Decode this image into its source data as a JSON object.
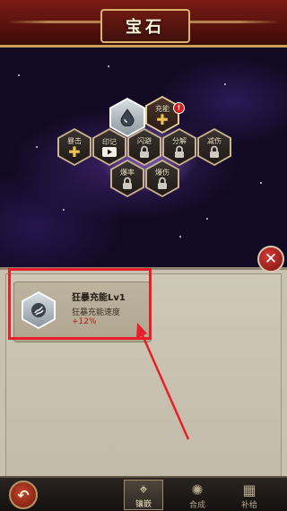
{
  "header": {
    "title": "宝石"
  },
  "gems": [
    {
      "id": "silver",
      "label": "",
      "icon": "water-drop-icon",
      "state": "unlocked"
    },
    {
      "id": "charge",
      "label": "充能",
      "icon": "plus-icon",
      "state": "unlocked",
      "badge": "!"
    },
    {
      "id": "crit",
      "label": "暴击",
      "icon": "plus-icon",
      "state": "unlocked"
    },
    {
      "id": "mark",
      "label": "印记",
      "icon": "video-icon",
      "state": "unlocked"
    },
    {
      "id": "dodge",
      "label": "闪避",
      "icon": "lock-icon",
      "state": "locked"
    },
    {
      "id": "decompose",
      "label": "分解",
      "icon": "lock-icon",
      "state": "locked"
    },
    {
      "id": "reduce",
      "label": "减伤",
      "icon": "lock-icon",
      "state": "locked"
    },
    {
      "id": "critrate",
      "label": "爆率",
      "icon": "lock-icon",
      "state": "locked"
    },
    {
      "id": "critdmg",
      "label": "爆伤",
      "icon": "lock-icon",
      "state": "locked"
    }
  ],
  "close": {
    "icon": "close-icon",
    "label": "✕"
  },
  "detail": {
    "name": "狂暴充能Lv1",
    "attribute": "狂暴充能速度",
    "value": "+12%"
  },
  "bottom": {
    "back_icon": "back-arrow-icon",
    "back_glyph": "↶",
    "tabs": [
      {
        "label": "镶嵌",
        "icon": "inlay-icon",
        "glyph": "⌖",
        "active": true
      },
      {
        "label": "合成",
        "icon": "compose-icon",
        "glyph": "✺",
        "active": false
      },
      {
        "label": "补给",
        "icon": "chest-icon",
        "glyph": "▦",
        "active": false
      }
    ]
  },
  "colors": {
    "accent_red": "#e81f2a",
    "header_red": "#7a1c14",
    "gold": "#d8b36c"
  }
}
